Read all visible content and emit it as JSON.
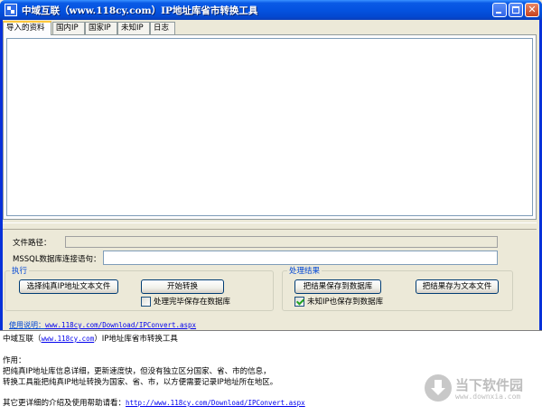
{
  "window": {
    "title": "中域互联（www.118cy.com）IP地址库省市转换工具",
    "controls": {
      "minimize": "minimize-icon",
      "maximize": "maximize-icon",
      "close": "close-icon"
    }
  },
  "tabs": [
    {
      "label": "导入的资料",
      "active": true
    },
    {
      "label": "国内IP",
      "active": false
    },
    {
      "label": "国家IP",
      "active": false
    },
    {
      "label": "未知IP",
      "active": false
    },
    {
      "label": "日志",
      "active": false
    }
  ],
  "form": {
    "file_path_label": "文件路径：",
    "file_path_value": "",
    "conn_label": "MSSQL数据库连接语句：",
    "conn_value": ""
  },
  "execute_group": {
    "title": "执行",
    "select_file_button": "选择纯真IP地址文本文件",
    "start_button": "开始转换",
    "save_db_checkbox": {
      "label": "处理完毕保存在数据库",
      "checked": false
    }
  },
  "result_group": {
    "title": "处理结果",
    "save_db_button": "把结果保存到数据库",
    "save_text_button": "把结果存为文本文件",
    "unknown_ip_checkbox": {
      "label": "未知IP也保存到数据库",
      "checked": true
    }
  },
  "help": {
    "label": "使用说明：",
    "url": "www.118cy.com/Download/IPConvert.aspx"
  },
  "info": {
    "line1_prefix": "中域互联（",
    "line1_link": "www.118cy.com",
    "line1_suffix": "）IP地址库省市转换工具",
    "line2": "作用：",
    "line3": "把纯真IP地址库信息详细，更新速度快，但没有独立区分国家、省、市的信息，",
    "line4": "转换工具能把纯真IP地址转换为国家、省、市，以方便需要记录IP地址所在地区。",
    "line5_prefix": "其它更详细的介绍及使用帮助请看：",
    "line5_link": "http://www.118cy.com/Download/IPConvert.aspx"
  },
  "watermark": {
    "text": "当下软件园",
    "url": "www.downxia.com",
    "icon": "download-arrow-icon"
  }
}
